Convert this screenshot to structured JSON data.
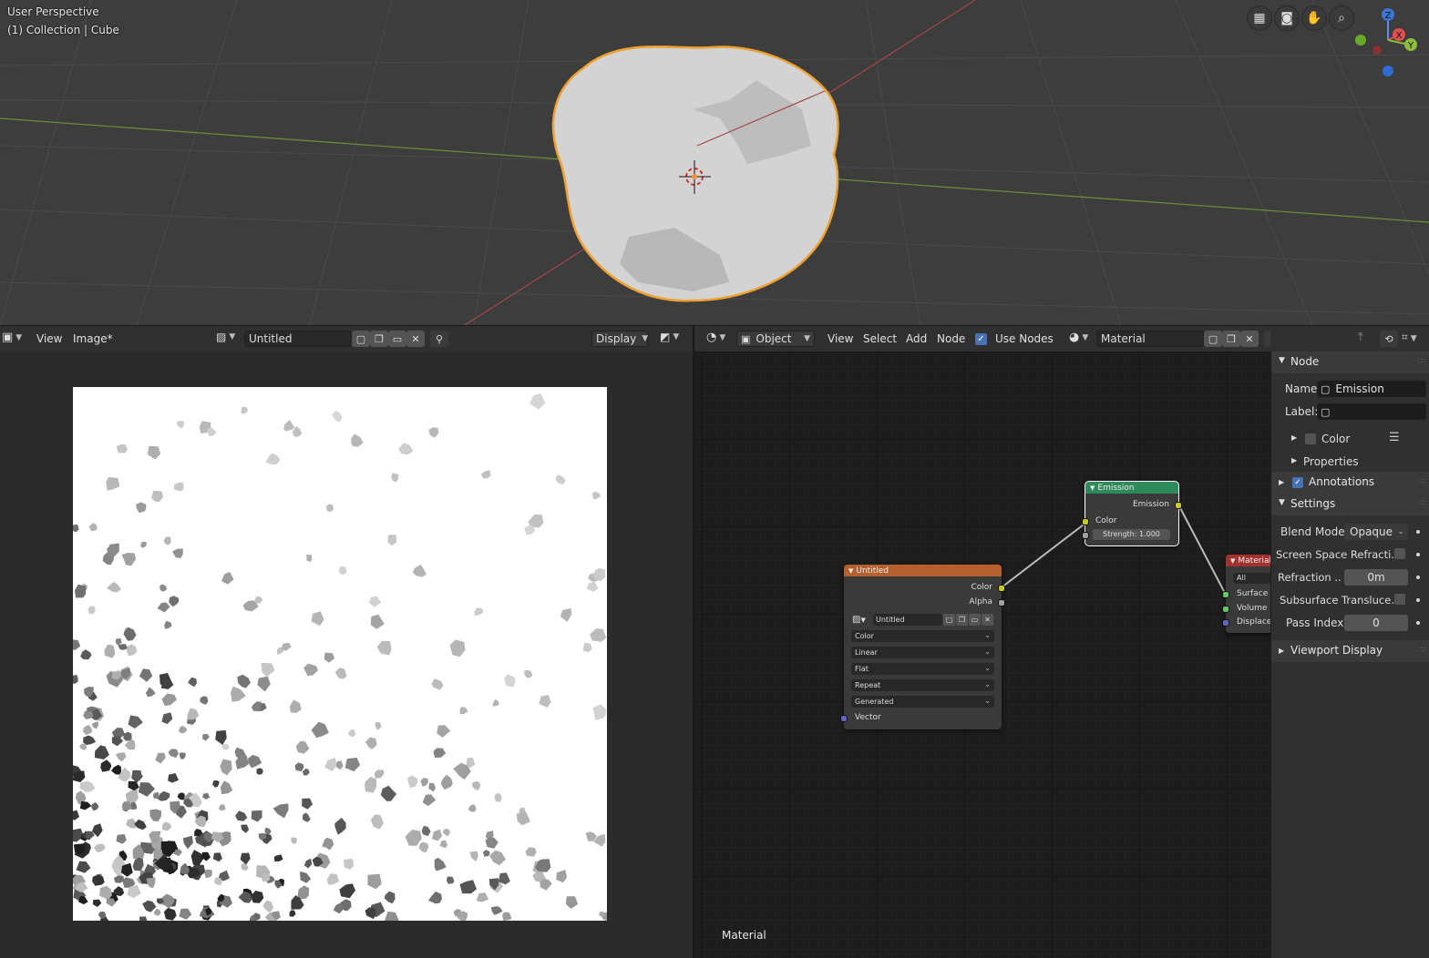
{
  "viewport": {
    "title": "User Perspective",
    "subtitle": "(1) Collection | Cube",
    "gizmo_axes": {
      "z": "Z",
      "x": "X",
      "y": "Y"
    }
  },
  "image_editor": {
    "menu_view": "View",
    "menu_image": "Image*",
    "image_name": "Untitled",
    "display_label": "Display"
  },
  "node_editor": {
    "object_mode": "Object",
    "menu_view": "View",
    "menu_select": "Select",
    "menu_add": "Add",
    "menu_node": "Node",
    "use_nodes_label": "Use Nodes",
    "use_nodes_checked": true,
    "material_name": "Material",
    "footer_label": "Material",
    "emission_node": {
      "title": "Emission",
      "output": "Emission",
      "input_color": "Color",
      "strength": "Strength: 1.000",
      "header_color": "#2e8a5a"
    },
    "image_node": {
      "title": "Untitled",
      "out_color": "Color",
      "out_alpha": "Alpha",
      "image_name": "Untitled",
      "options": [
        "Color",
        "Linear",
        "Flat",
        "Repeat",
        "Generated"
      ],
      "input_vector": "Vector",
      "header_color": "#b5602c"
    },
    "output_node": {
      "title": "Material O",
      "target": "All",
      "in_surface": "Surface",
      "in_volume": "Volume",
      "in_displacement": "Displacem",
      "header_color": "#a3312f"
    }
  },
  "sidebar": {
    "node_panel": "Node",
    "name_label": "Name:",
    "name_value": "Emission",
    "label_label": "Label:",
    "label_value": "",
    "color_label": "Color",
    "properties_label": "Properties",
    "annotations_label": "Annotations",
    "settings_panel": "Settings",
    "blend_mode_label": "Blend Mode",
    "blend_mode_value": "Opaque",
    "ssr_label": "Screen Space Refracti...",
    "refraction_label": "Refraction ..",
    "refraction_value": "0m",
    "subsurface_label": "Subsurface Transluce..",
    "pass_index_label": "Pass Index",
    "pass_index_value": "0",
    "viewport_display_label": "Viewport Display"
  }
}
